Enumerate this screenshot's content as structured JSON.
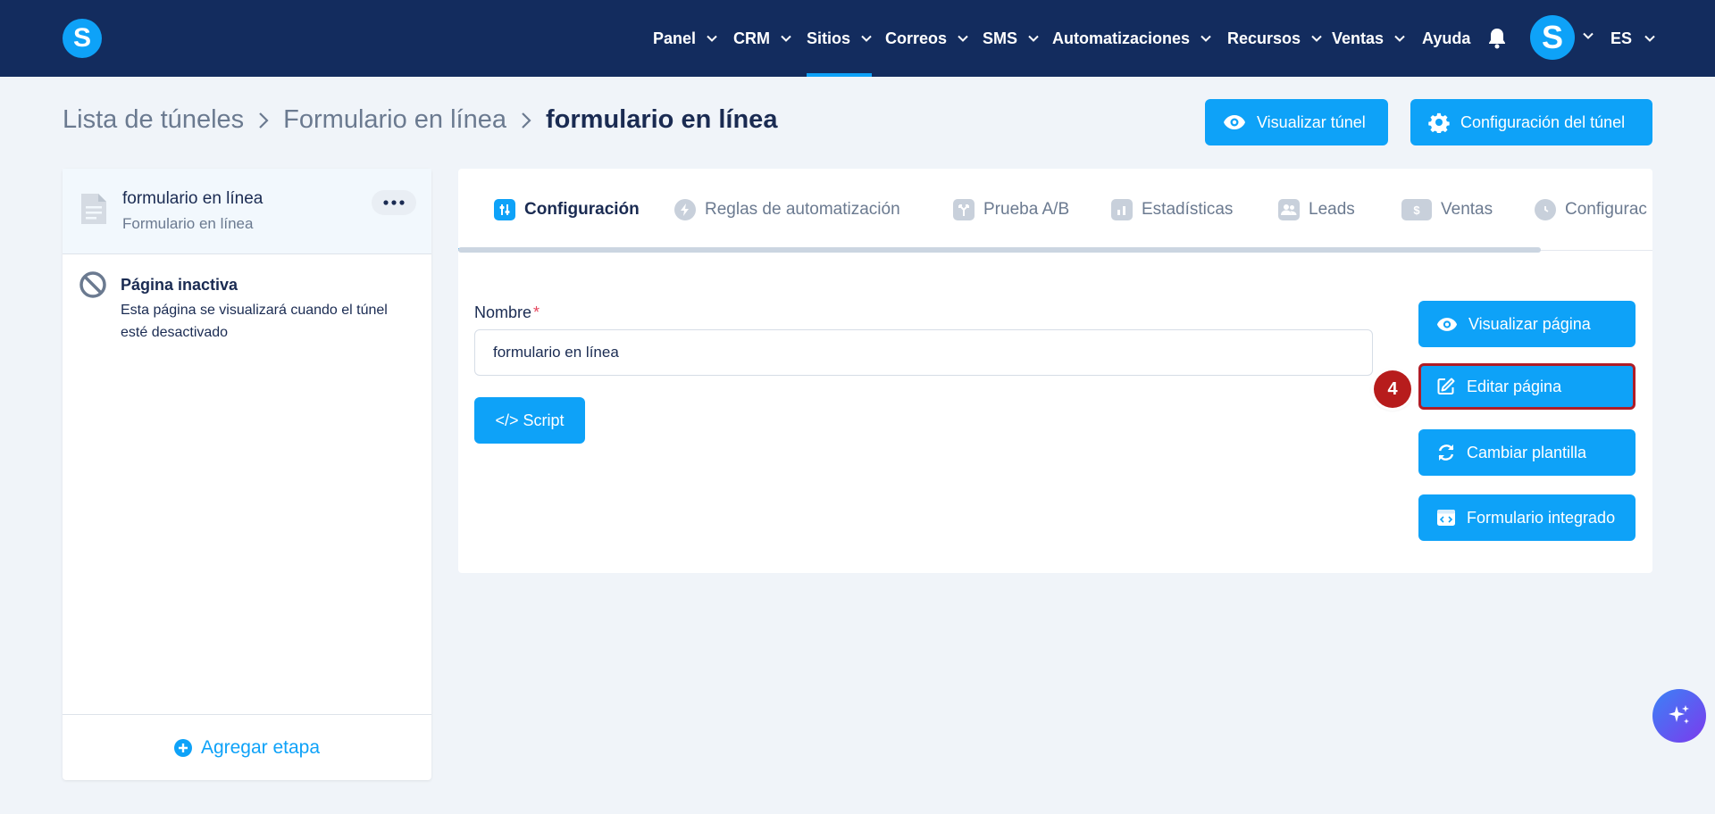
{
  "nav": {
    "logo": "S",
    "items": [
      {
        "label": "Panel"
      },
      {
        "label": "CRM"
      },
      {
        "label": "Sitios"
      },
      {
        "label": "Correos"
      },
      {
        "label": "SMS"
      },
      {
        "label": "Automatizaciones"
      },
      {
        "label": "Recursos"
      },
      {
        "label": "Ventas"
      },
      {
        "label": "Ayuda"
      }
    ],
    "active_item": "Sitios",
    "avatar_letter": "S",
    "language": "ES"
  },
  "breadcrumb": {
    "items": [
      "Lista de túneles",
      "Formulario en línea"
    ],
    "current": "formulario en línea"
  },
  "header_buttons": {
    "view_funnel": "Visualizar túnel",
    "funnel_settings": "Configuración del túnel"
  },
  "sidebar": {
    "step": {
      "title": "formulario en línea",
      "subtitle": "Formulario en línea"
    },
    "inactive_page": {
      "title": "Página inactiva",
      "description": "Esta página se visualizará cuando el túnel esté desactivado"
    },
    "add_step": "Agregar etapa"
  },
  "tabs": [
    {
      "label": "Configuración",
      "icon": "sliders-icon"
    },
    {
      "label": "Reglas de automatización",
      "icon": "bolt-icon"
    },
    {
      "label": "Prueba A/B",
      "icon": "split-icon"
    },
    {
      "label": "Estadísticas",
      "icon": "bar-chart-icon"
    },
    {
      "label": "Leads",
      "icon": "users-icon"
    },
    {
      "label": "Ventas",
      "icon": "dollar-icon"
    },
    {
      "label": "Configurac",
      "icon": "clock-icon"
    }
  ],
  "active_tab": "Configuración",
  "form": {
    "name_label": "Nombre",
    "required_mark": "*",
    "name_value": "formulario en línea",
    "script_button": "</> Script"
  },
  "page_actions": {
    "view_page": "Visualizar página",
    "edit_page": "Editar página",
    "change_template": "Cambiar plantilla",
    "embedded_form": "Formulario integrado"
  },
  "annotation": {
    "step_number": "4"
  },
  "colors": {
    "nav_bg": "#132c5e",
    "primary": "#0ea2f8",
    "page_bg": "#f0f4f9",
    "highlight": "#b01d27"
  }
}
